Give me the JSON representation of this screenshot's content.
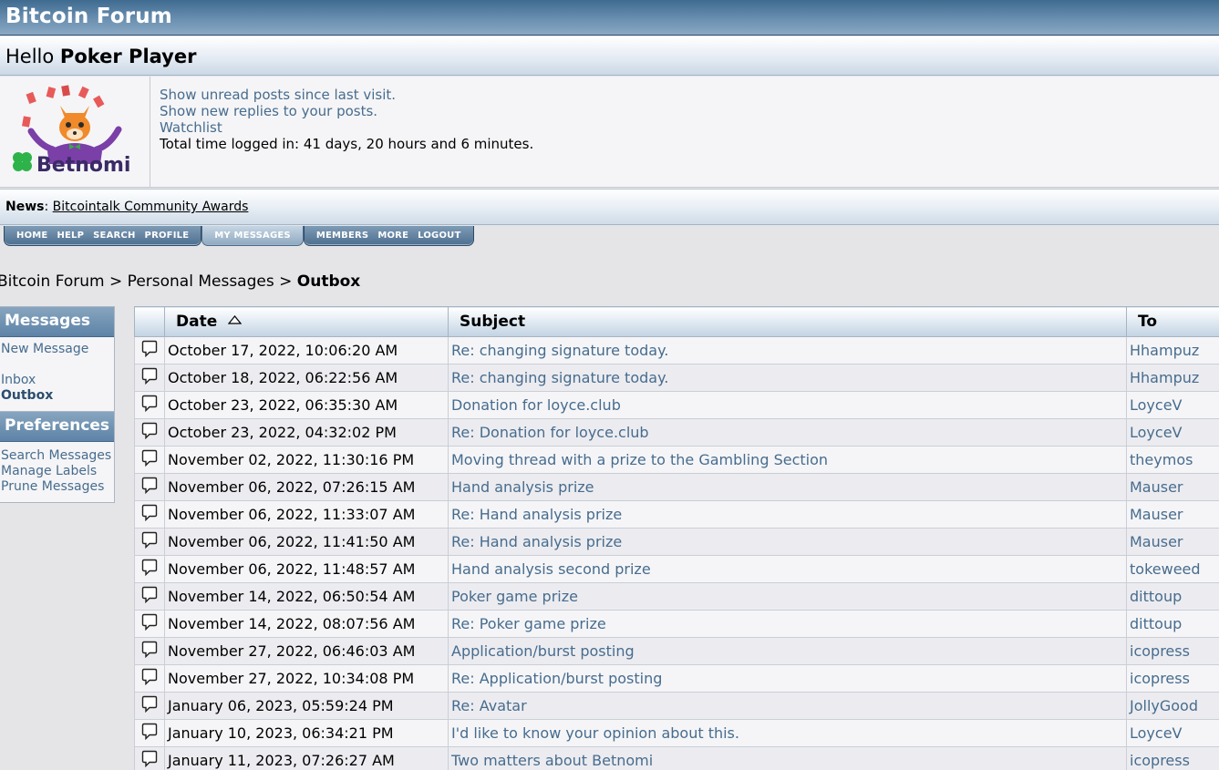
{
  "header": {
    "site_title": "Bitcoin Forum"
  },
  "hello": {
    "greeting": "Hello",
    "username": "Poker Player"
  },
  "avatar": {
    "text": "Betnomi"
  },
  "user_links": {
    "unread": "Show unread posts since last visit.",
    "replies": "Show new replies to your posts.",
    "watchlist": "Watchlist",
    "time_logged": "Total time logged in: 41 days, 20 hours and 6 minutes."
  },
  "news": {
    "label": "News",
    "text": "Bitcointalk Community Awards"
  },
  "menu": {
    "home": "HOME",
    "help": "HELP",
    "search": "SEARCH",
    "profile": "PROFILE",
    "my_messages": "MY MESSAGES",
    "members": "MEMBERS",
    "more": "MORE",
    "logout": "LOGOUT"
  },
  "breadcrumb": {
    "root": "Bitcoin Forum",
    "sep": ">",
    "section": "Personal Messages",
    "current": "Outbox"
  },
  "sidebar": {
    "messages_header": "Messages",
    "new_message": "New Message",
    "inbox": "Inbox",
    "outbox": "Outbox",
    "preferences_header": "Preferences",
    "search_messages": "Search Messages",
    "manage_labels": "Manage Labels",
    "prune_messages": "Prune Messages"
  },
  "table": {
    "col_date": "Date",
    "col_subject": "Subject",
    "col_to": "To",
    "rows": [
      {
        "date": "October 17, 2022, 10:06:20 AM",
        "subject": "Re: changing signature today.",
        "to": "Hhampuz"
      },
      {
        "date": "October 18, 2022, 06:22:56 AM",
        "subject": "Re: changing signature today.",
        "to": "Hhampuz"
      },
      {
        "date": "October 23, 2022, 06:35:30 AM",
        "subject": "Donation for loyce.club",
        "to": "LoyceV"
      },
      {
        "date": "October 23, 2022, 04:32:02 PM",
        "subject": "Re: Donation for loyce.club",
        "to": "LoyceV"
      },
      {
        "date": "November 02, 2022, 11:30:16 PM",
        "subject": "Moving thread with a prize to the Gambling Section",
        "to": "theymos"
      },
      {
        "date": "November 06, 2022, 07:26:15 AM",
        "subject": "Hand analysis prize",
        "to": "Mauser"
      },
      {
        "date": "November 06, 2022, 11:33:07 AM",
        "subject": "Re: Hand analysis prize",
        "to": "Mauser"
      },
      {
        "date": "November 06, 2022, 11:41:50 AM",
        "subject": "Re: Hand analysis prize",
        "to": "Mauser"
      },
      {
        "date": "November 06, 2022, 11:48:57 AM",
        "subject": "Hand analysis second prize",
        "to": "tokeweed"
      },
      {
        "date": "November 14, 2022, 06:50:54 AM",
        "subject": "Poker game prize",
        "to": "dittoup"
      },
      {
        "date": "November 14, 2022, 08:07:56 AM",
        "subject": "Re: Poker game prize",
        "to": "dittoup"
      },
      {
        "date": "November 27, 2022, 06:46:03 AM",
        "subject": "Application/burst posting",
        "to": "icopress"
      },
      {
        "date": "November 27, 2022, 10:34:08 PM",
        "subject": "Re: Application/burst posting",
        "to": "icopress"
      },
      {
        "date": "January 06, 2023, 05:59:24 PM",
        "subject": "Re: Avatar",
        "to": "JollyGood"
      },
      {
        "date": "January 10, 2023, 06:34:21 PM",
        "subject": "I'd like to know your opinion about this.",
        "to": "LoyceV"
      },
      {
        "date": "January 11, 2023, 07:26:27 AM",
        "subject": "Two matters about Betnomi",
        "to": "icopress"
      }
    ]
  }
}
